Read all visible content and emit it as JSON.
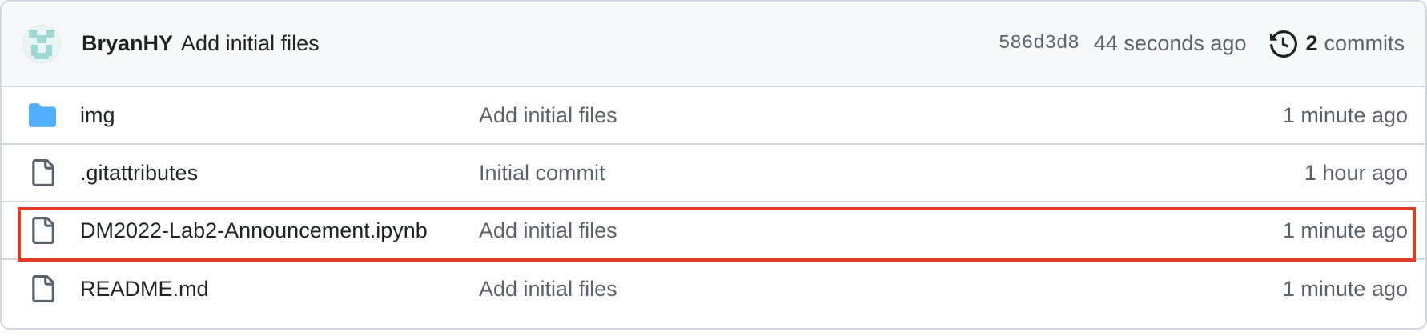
{
  "latest_commit": {
    "author": "BryanHY",
    "message": "Add initial files",
    "sha": "586d3d8",
    "time": "44 seconds ago",
    "commits_count": "2",
    "commits_label": "commits"
  },
  "files": [
    {
      "type": "folder",
      "name": "img",
      "message": "Add initial files",
      "age": "1 minute ago"
    },
    {
      "type": "file",
      "name": ".gitattributes",
      "message": "Initial commit",
      "age": "1 hour ago"
    },
    {
      "type": "file",
      "name": "DM2022-Lab2-Announcement.ipynb",
      "message": "Add initial files",
      "age": "1 minute ago"
    },
    {
      "type": "file",
      "name": "README.md",
      "message": "Add initial files",
      "age": "1 minute ago"
    }
  ],
  "colors": {
    "highlight": "#e03c26",
    "folder": "#54aeff",
    "border": "#d0d7de",
    "header_bg": "#f6f8fa"
  },
  "icons": {
    "folder": "folder-icon",
    "file": "file-icon",
    "history": "history-icon"
  }
}
